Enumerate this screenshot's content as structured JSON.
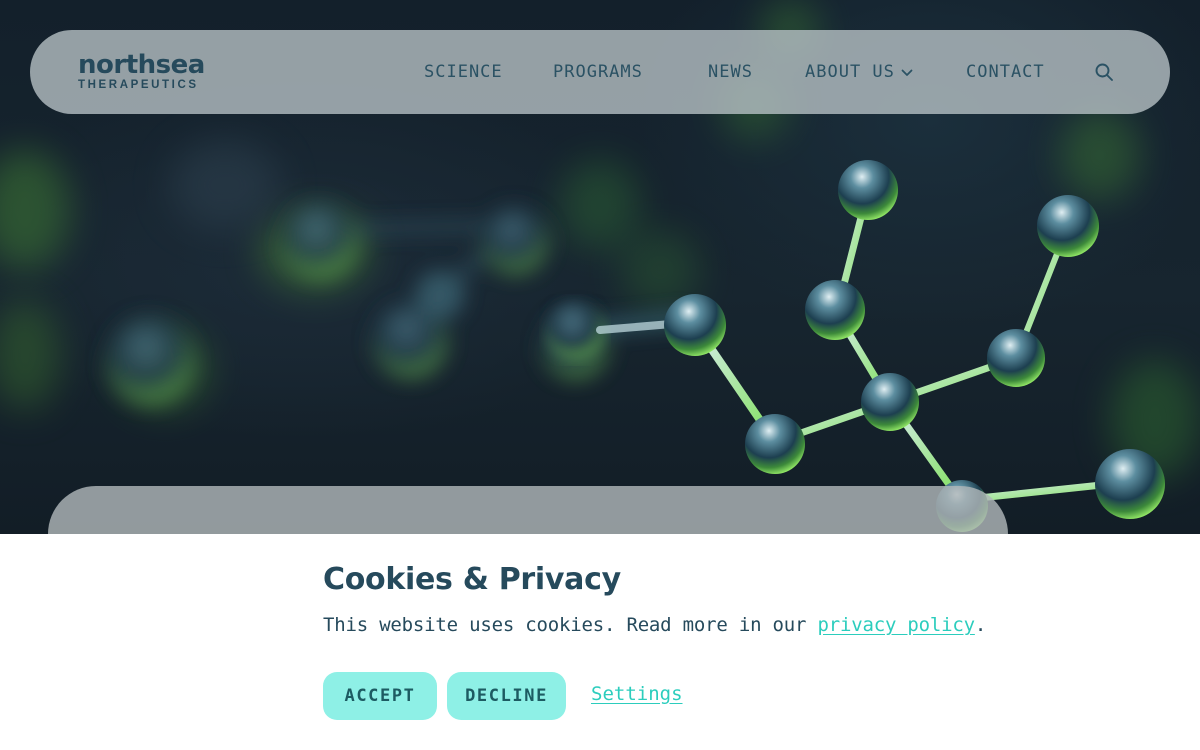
{
  "brand": {
    "name": "northsea",
    "tagline": "THERAPEUTICS"
  },
  "nav": {
    "items": [
      {
        "label": "SCIENCE"
      },
      {
        "label": "PROGRAMS"
      },
      {
        "label": "NEWS"
      },
      {
        "label": "ABOUT US",
        "has_dropdown": true
      },
      {
        "label": "CONTACT"
      }
    ],
    "search_icon": "search-icon"
  },
  "hero": {
    "image": "molecule-structure-illustration"
  },
  "cookie_banner": {
    "title": "Cookies & Privacy",
    "text_before_link": "This website uses cookies. Read more in our ",
    "link_label": "privacy policy",
    "text_after_link": ".",
    "accept_label": "ACCEPT",
    "decline_label": "DECLINE",
    "settings_label": "Settings"
  },
  "colors": {
    "brand_dark": "#264a5c",
    "accent": "#2ccdbd",
    "button_bg": "#8ef0e6",
    "molecule_green": "#7fe05a"
  }
}
